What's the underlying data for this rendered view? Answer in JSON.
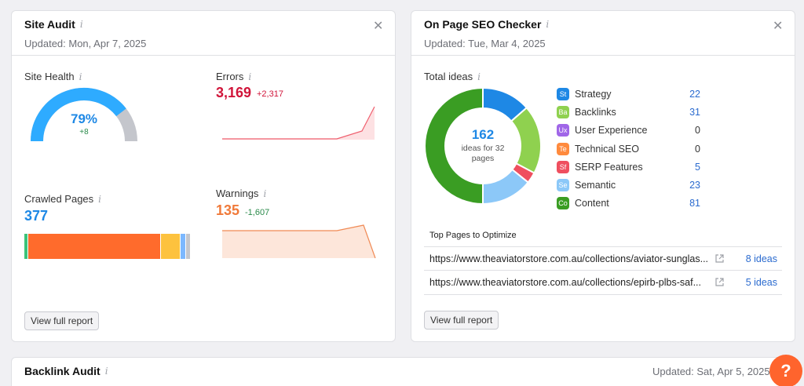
{
  "site_audit": {
    "title": "Site Audit",
    "updated": "Updated: Mon, Apr 7, 2025",
    "site_health": {
      "label": "Site Health",
      "value": "79%",
      "delta": "+8",
      "fraction": 0.79
    },
    "errors": {
      "label": "Errors",
      "value": "3,169",
      "delta": "+2,317"
    },
    "crawled": {
      "label": "Crawled Pages",
      "value": "377",
      "segments": [
        {
          "share": 0.02,
          "color": "#3cc37a"
        },
        {
          "share": 0.8,
          "color": "#ff6b2c"
        },
        {
          "share": 0.12,
          "color": "#fdc23e"
        },
        {
          "share": 0.03,
          "color": "#7cb8ff"
        },
        {
          "share": 0.03,
          "color": "#c4c6cc"
        }
      ]
    },
    "warnings": {
      "label": "Warnings",
      "value": "135",
      "delta": "-1,607"
    },
    "view_full": "View full report"
  },
  "on_page": {
    "title": "On Page SEO Checker",
    "updated": "Updated: Tue, Mar 4, 2025",
    "total_label": "Total ideas",
    "center_value": "162",
    "center_sub": "ideas for 32 pages",
    "legend": [
      {
        "abbr": "St",
        "label": "Strategy",
        "value": "22",
        "color": "#1e88e5",
        "num": 22
      },
      {
        "abbr": "Ba",
        "label": "Backlinks",
        "value": "31",
        "color": "#8fd14f",
        "num": 31
      },
      {
        "abbr": "Ux",
        "label": "User Experience",
        "value": "0",
        "color": "#a066e8",
        "num": 0
      },
      {
        "abbr": "Te",
        "label": "Technical SEO",
        "value": "0",
        "color": "#ff8a3d",
        "num": 0
      },
      {
        "abbr": "Sf",
        "label": "SERP Features",
        "value": "5",
        "color": "#ef4f5f",
        "num": 5
      },
      {
        "abbr": "Se",
        "label": "Semantic",
        "value": "23",
        "color": "#8cc8f8",
        "num": 23
      },
      {
        "abbr": "Co",
        "label": "Content",
        "value": "81",
        "color": "#3a9d23",
        "num": 81
      }
    ],
    "top_pages_title": "Top Pages to Optimize",
    "pages": [
      {
        "url": "https://www.theaviatorstore.com.au/collections/aviator-sunglas...",
        "ideas": "8 ideas"
      },
      {
        "url": "https://www.theaviatorstore.com.au/collections/epirb-plbs-saf...",
        "ideas": "5 ideas"
      }
    ],
    "view_full": "View full report"
  },
  "backlink": {
    "title": "Backlink Audit",
    "updated": "Updated: Sat, Apr 5, 2025"
  },
  "help": {
    "label": "?"
  }
}
